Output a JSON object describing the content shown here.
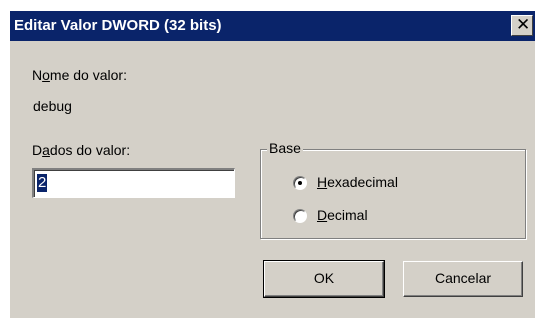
{
  "window": {
    "title": "Editar Valor DWORD (32 bits)",
    "close_glyph": "✕"
  },
  "value_name": {
    "label_pre": "N",
    "label_accel": "o",
    "label_post": "me do valor:",
    "value": "debug"
  },
  "value_data": {
    "label_pre": "D",
    "label_accel": "a",
    "label_post": "dos do valor:",
    "value": "2"
  },
  "base": {
    "legend": "Base",
    "options": [
      {
        "label_accel": "H",
        "label_post": "exadecimal",
        "selected": true
      },
      {
        "label_accel": "D",
        "label_post": "ecimal",
        "selected": false
      }
    ]
  },
  "buttons": {
    "ok": "OK",
    "cancel": "Cancelar"
  }
}
